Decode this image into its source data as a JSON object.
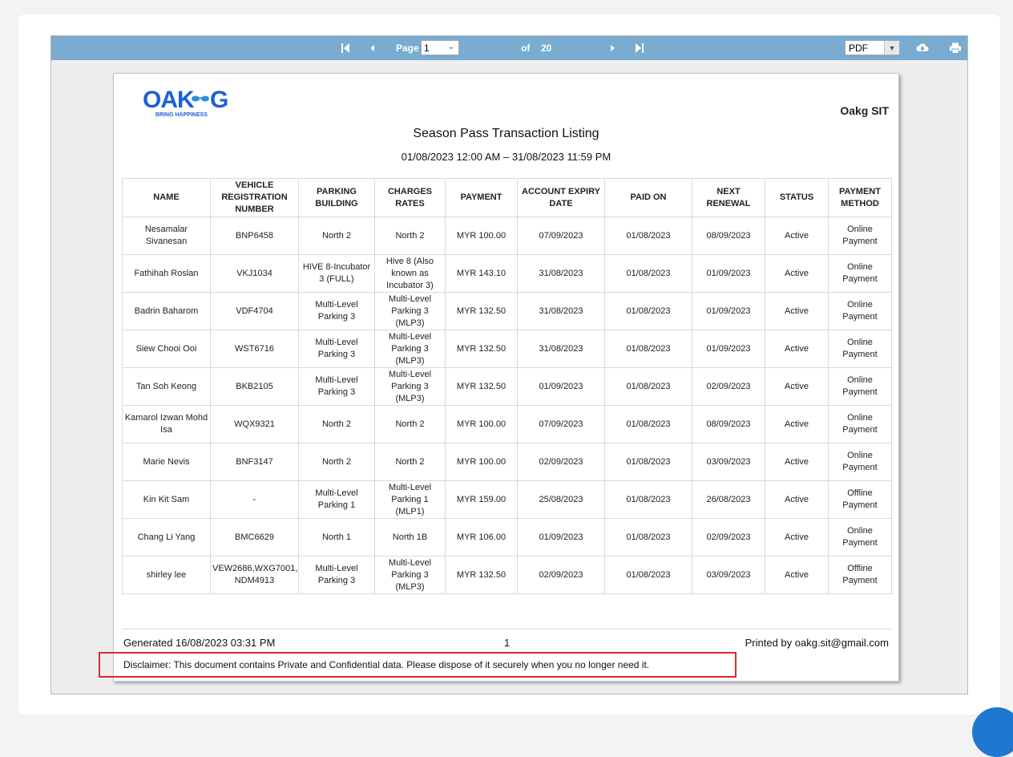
{
  "toolbar": {
    "page_label": "Page",
    "current_page": "1",
    "of_label": "of",
    "total_pages": "20",
    "export_format": "PDF"
  },
  "report": {
    "logo_text": "OAK G",
    "logo_tagline": "BRING HAPPINESS",
    "company": "Oakg SIT",
    "title": "Season Pass Transaction Listing",
    "date_range": "01/08/2023 12:00 AM – 31/08/2023 11:59 PM",
    "columns": [
      "NAME",
      "VEHICLE REGISTRATION NUMBER",
      "PARKING BUILDING",
      "CHARGES RATES",
      "PAYMENT",
      "ACCOUNT EXPIRY DATE",
      "PAID ON",
      "NEXT RENEWAL",
      "STATUS",
      "PAYMENT METHOD"
    ],
    "rows": [
      [
        "Nesamalar Sivanesan",
        "BNP6458",
        "North 2",
        "North 2",
        "MYR 100.00",
        "07/09/2023",
        "01/08/2023",
        "08/09/2023",
        "Active",
        "Online Payment"
      ],
      [
        "Fathihah Roslan",
        "VKJ1034",
        "HIVE 8-Incubator 3 (FULL)",
        "Hive 8 (Also known as Incubator 3)",
        "MYR 143.10",
        "31/08/2023",
        "01/08/2023",
        "01/09/2023",
        "Active",
        "Online Payment"
      ],
      [
        "Badrin Baharom",
        "VDF4704",
        "Multi-Level Parking 3",
        "Multi-Level Parking 3 (MLP3)",
        "MYR 132.50",
        "31/08/2023",
        "01/08/2023",
        "01/09/2023",
        "Active",
        "Online Payment"
      ],
      [
        "Siew Chooi Ooi",
        "WST6716",
        "Multi-Level Parking 3",
        "Multi-Level Parking 3 (MLP3)",
        "MYR 132.50",
        "31/08/2023",
        "01/08/2023",
        "01/09/2023",
        "Active",
        "Online Payment"
      ],
      [
        "Tan  Soh Keong",
        "BKB2105",
        "Multi-Level Parking 3",
        "Multi-Level Parking 3 (MLP3)",
        "MYR 132.50",
        "01/09/2023",
        "01/08/2023",
        "02/09/2023",
        "Active",
        "Online Payment"
      ],
      [
        "Kamarol Izwan Mohd Isa",
        "WQX9321",
        "North 2",
        "North 2",
        "MYR 100.00",
        "07/09/2023",
        "01/08/2023",
        "08/09/2023",
        "Active",
        "Online Payment"
      ],
      [
        "Marie Nevis",
        "BNF3147",
        "North 2",
        "North 2",
        "MYR 100.00",
        "02/09/2023",
        "01/08/2023",
        "03/09/2023",
        "Active",
        "Online Payment"
      ],
      [
        "Kin Kit Sam",
        "-",
        "Multi-Level Parking 1",
        "Multi-Level Parking 1 (MLP1)",
        "MYR 159.00",
        "25/08/2023",
        "01/08/2023",
        "26/08/2023",
        "Active",
        "Offline Payment"
      ],
      [
        "Chang Li Yang",
        "BMC6629",
        "North 1",
        "North 1B",
        "MYR 106.00",
        "01/09/2023",
        "01/08/2023",
        "02/09/2023",
        "Active",
        "Online Payment"
      ],
      [
        "shirley lee",
        "VEW2686,WXG7001, NDM4913",
        "Multi-Level Parking 3",
        "Multi-Level Parking 3 (MLP3)",
        "MYR 132.50",
        "02/09/2023",
        "01/08/2023",
        "03/09/2023",
        "Active",
        "Offline Payment"
      ]
    ],
    "generated": "Generated 16/08/2023 03:31 PM",
    "page_number": "1",
    "printed_by": "Printed by oakg.sit@gmail.com",
    "disclaimer": "Disclaimer: This document contains Private and Confidential data. Please dispose of it securely when you no longer need it."
  },
  "colors": {
    "toolbar": "#7aabd0",
    "logo_blue": "#1f5fd6",
    "highlight": "#d62c2c"
  }
}
